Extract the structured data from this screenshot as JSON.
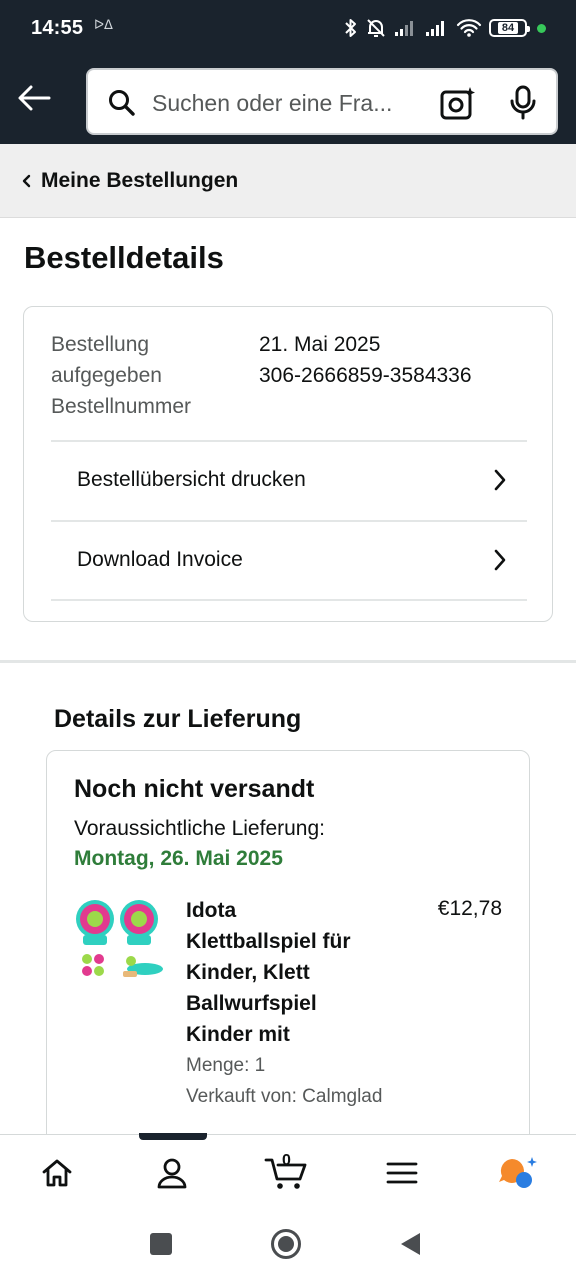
{
  "status_bar": {
    "time": "14:55",
    "small_indicator": "ᐅᐃ",
    "battery": "84"
  },
  "search": {
    "placeholder": "Suchen oder eine Fra..."
  },
  "breadcrumb": {
    "label": "Meine Bestellungen"
  },
  "page": {
    "title": "Bestelldetails"
  },
  "order": {
    "placed_label_1": "Bestellung",
    "placed_label_2": "aufgegeben",
    "number_label": "Bestellnummer",
    "placed_value": "21. Mai 2025",
    "number_value": "306-2666859-3584336",
    "actions": [
      {
        "label": "Bestellübersicht drucken"
      },
      {
        "label": "Download Invoice"
      }
    ]
  },
  "delivery": {
    "heading": "Details zur Lieferung",
    "status": "Noch nicht versandt",
    "eta_label": "Voraussichtliche Lieferung:",
    "eta_date": "Montag, 26. Mai 2025",
    "eta_color": "#2f7d3a",
    "item": {
      "title_lines": [
        "Idota",
        "Klettballspiel für",
        "Kinder, Klett",
        "Ballwurfspiel",
        "Kinder mit"
      ],
      "price": "€12,78",
      "quantity": "Menge: 1",
      "seller": "Verkauft von: Calmglad"
    }
  },
  "bottom_nav": {
    "cart_count": "0",
    "items": [
      "home-icon",
      "account-icon",
      "cart-icon",
      "menu-icon",
      "rufus-icon"
    ]
  },
  "colors": {
    "header_bg": "#1a232d",
    "accent_green": "#2f7d3a"
  }
}
